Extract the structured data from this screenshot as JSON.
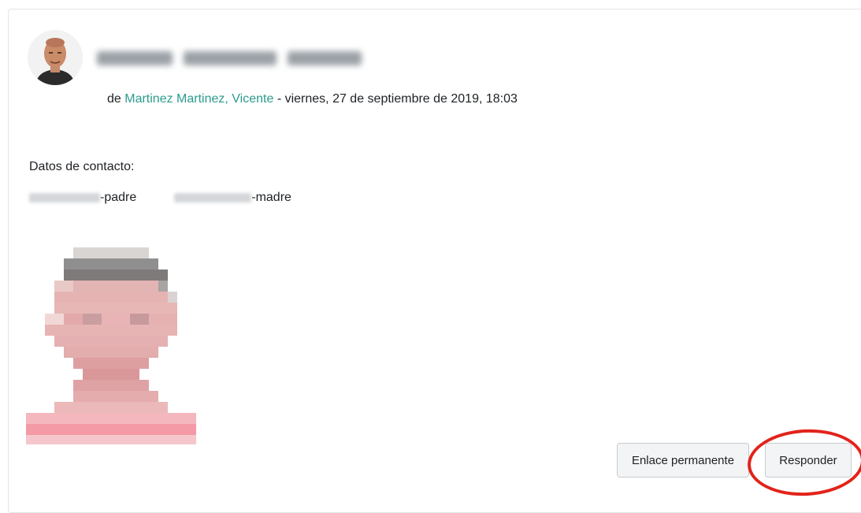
{
  "post": {
    "subject": "",
    "byline_prefix": "de ",
    "author": "Martinez Martinez, Vicente",
    "byline_separator": " - ",
    "date": "viernes, 27 de septiembre de 2019, 18:03"
  },
  "content": {
    "contact_heading": "Datos de contacto:",
    "contact_father_suffix": "-padre",
    "contact_mother_suffix": "-madre"
  },
  "actions": {
    "permalink_label": "Enlace permanente",
    "reply_label": "Responder"
  },
  "colors": {
    "link": "#2b9c8e",
    "highlight": "#e2231a",
    "button_bg": "#f3f4f5",
    "button_border": "#c8ccd0"
  }
}
